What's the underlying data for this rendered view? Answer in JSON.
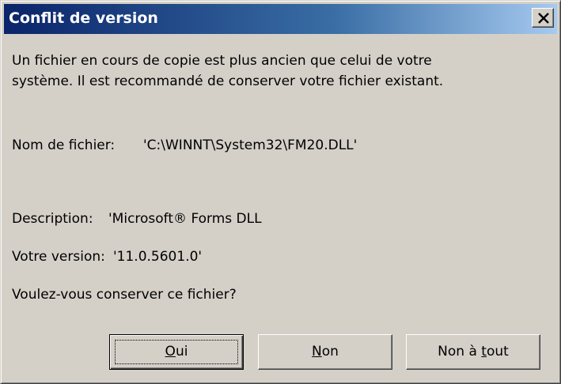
{
  "dialog": {
    "title": "Conflit de version",
    "message_line1": "Un fichier en cours de copie est plus ancien que celui de votre",
    "message_line2": "système. Il est recommandé de conserver votre fichier existant.",
    "filename_label": "Nom de fichier:",
    "filename_value": "'C:\\WINNT\\System32\\FM20.DLL'",
    "description_label": "Description:",
    "description_value": "'Microsoft® Forms DLL",
    "version_label": "Votre version:",
    "version_value": "'11.0.5601.0'",
    "question": "Voulez-vous conserver ce fichier?"
  },
  "buttons": {
    "oui": {
      "mnemonic": "O",
      "rest": "ui"
    },
    "non": {
      "mnemonic": "N",
      "rest": "on"
    },
    "non_a_tout": {
      "prefix": "Non à ",
      "mnemonic": "t",
      "rest": "out"
    }
  },
  "icons": {
    "close": "close-x-icon"
  },
  "colors": {
    "title_start": "#0a246a",
    "title_end": "#a6caf0",
    "face": "#d4d0c8"
  }
}
